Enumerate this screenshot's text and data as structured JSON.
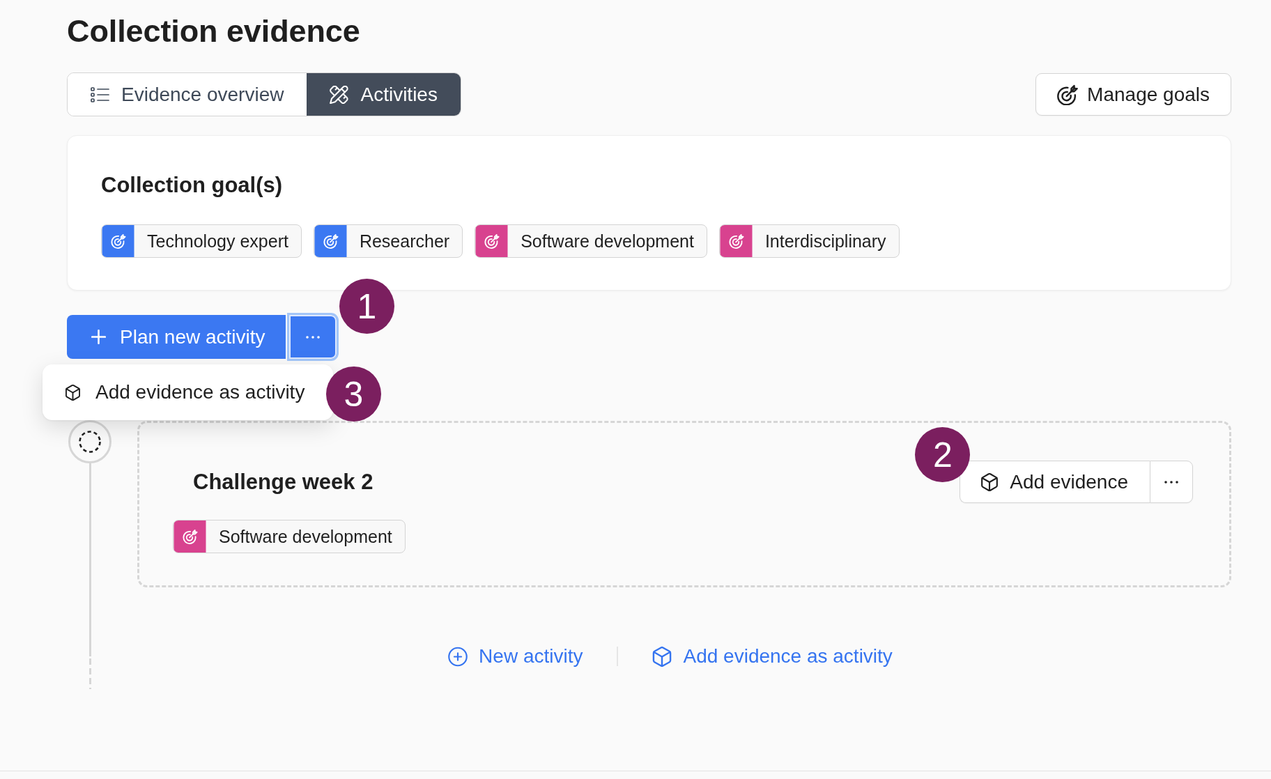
{
  "page": {
    "title": "Collection evidence"
  },
  "tabs": [
    {
      "kind": "overview",
      "label": "Evidence overview",
      "selected": false
    },
    {
      "kind": "activities",
      "label": "Activities",
      "selected": true
    }
  ],
  "manage_goals_button": {
    "label": "Manage goals"
  },
  "goals_panel": {
    "title": "Collection goal(s)",
    "goals": [
      {
        "label": "Technology expert",
        "color": "#3b78f2"
      },
      {
        "label": "Researcher",
        "color": "#3b78f2"
      },
      {
        "label": "Software development",
        "color": "#d8428f"
      },
      {
        "label": "Interdisciplinary",
        "color": "#d8428f"
      }
    ]
  },
  "plan_button": {
    "label": "Plan new activity",
    "focused": true,
    "callout": "1",
    "menu_open": true,
    "menu": [
      {
        "label": "Add evidence as activity",
        "callout": "3"
      }
    ]
  },
  "activities": [
    {
      "kind": "planned",
      "title": "Challenge week 2",
      "goals": [
        {
          "label": "Software development",
          "color": "#d8428f"
        }
      ],
      "action": {
        "label": "Add evidence",
        "callout": "2"
      }
    }
  ],
  "footer_actions": [
    {
      "kind": "new",
      "label": "New activity"
    },
    {
      "kind": "evidence",
      "label": "Add evidence as activity"
    }
  ]
}
